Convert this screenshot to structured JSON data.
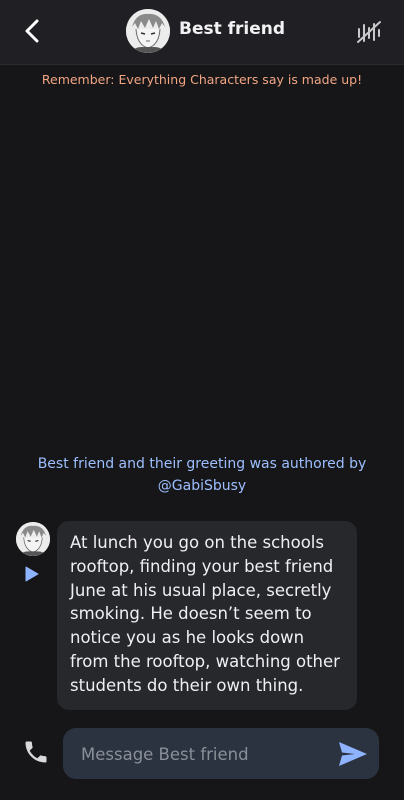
{
  "header": {
    "title": "Best friend",
    "back_icon": "chevron-left-icon",
    "voice_icon": "voice-wave-icon"
  },
  "disclaimer": "Remember: Everything Characters say is made up!",
  "credit": {
    "text": "Best friend and their greeting was authored by",
    "author": "@GabiSbusy"
  },
  "message": {
    "text": "At lunch you go on the schools rooftop, finding your best friend June at his usual place, secretly smoking. He doesn’t seem to notice you as he looks down from the rooftop, watching other students do their own thing.",
    "play_icon": "play-icon"
  },
  "composer": {
    "placeholder": "Message Best friend",
    "value": "",
    "send_icon": "send-icon",
    "call_icon": "phone-icon"
  },
  "colors": {
    "background": "#161618",
    "header": "#202024",
    "disclaimer": "#f0a583",
    "credit": "#9ebfff",
    "bubble": "#27282c",
    "composer": "#2b3340",
    "accent": "#8fb4ff"
  }
}
